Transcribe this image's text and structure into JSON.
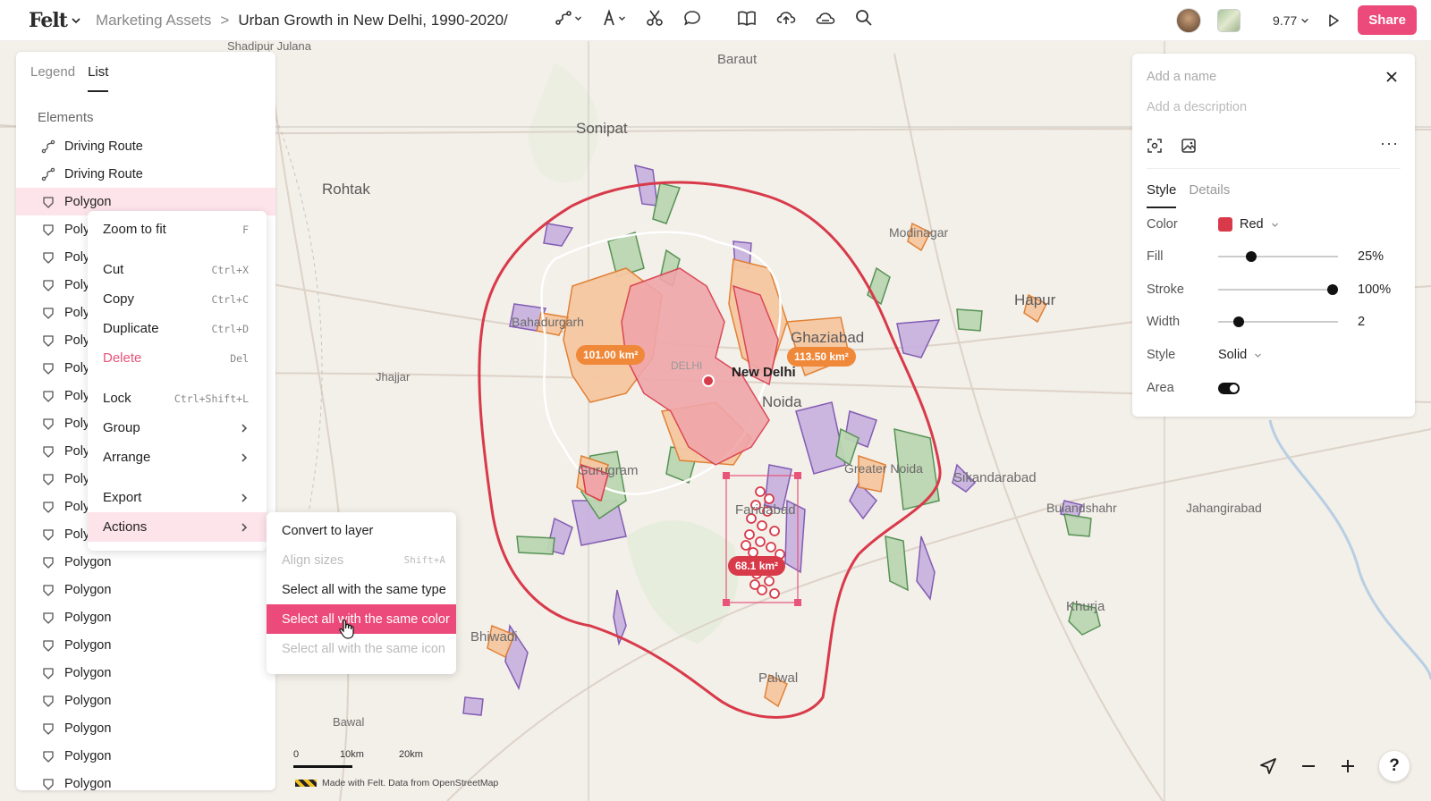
{
  "header": {
    "logo": "Felt",
    "breadcrumb_parent": "Marketing Assets",
    "breadcrumb_separator": ">",
    "map_title": "Urban Growth in New Delhi, 1990-2020/",
    "zoom": "9.77",
    "share_label": "Share"
  },
  "left_panel": {
    "tabs": [
      "Legend",
      "List"
    ],
    "section_title": "Elements",
    "items": [
      {
        "label": "Driving Route",
        "icon": "route-icon"
      },
      {
        "label": "Driving Route",
        "icon": "route-icon"
      },
      {
        "label": "Polygon",
        "icon": "polygon-icon",
        "selected": true
      },
      {
        "label": "Polygon",
        "icon": "polygon-icon"
      },
      {
        "label": "Polygon",
        "icon": "polygon-icon"
      },
      {
        "label": "Polygon",
        "icon": "polygon-icon"
      },
      {
        "label": "Polygon",
        "icon": "polygon-icon"
      },
      {
        "label": "Polygon",
        "icon": "polygon-icon"
      },
      {
        "label": "Polygon",
        "icon": "polygon-icon"
      },
      {
        "label": "Polygon",
        "icon": "polygon-icon"
      },
      {
        "label": "Polygon",
        "icon": "polygon-icon"
      },
      {
        "label": "Polygon",
        "icon": "polygon-icon"
      },
      {
        "label": "Polygon",
        "icon": "polygon-icon"
      },
      {
        "label": "Polygon",
        "icon": "polygon-icon"
      },
      {
        "label": "Polygon",
        "icon": "polygon-icon"
      },
      {
        "label": "Polygon",
        "icon": "polygon-icon"
      },
      {
        "label": "Polygon",
        "icon": "polygon-icon"
      },
      {
        "label": "Polygon",
        "icon": "polygon-icon"
      },
      {
        "label": "Polygon",
        "icon": "polygon-icon"
      },
      {
        "label": "Polygon",
        "icon": "polygon-icon"
      },
      {
        "label": "Polygon",
        "icon": "polygon-icon"
      },
      {
        "label": "Polygon",
        "icon": "polygon-icon"
      },
      {
        "label": "Polygon",
        "icon": "polygon-icon"
      },
      {
        "label": "Polygon",
        "icon": "polygon-icon"
      }
    ]
  },
  "context_menu": {
    "zoom_to_fit": {
      "label": "Zoom to fit",
      "shortcut": "F"
    },
    "cut": {
      "label": "Cut",
      "shortcut": "Ctrl+X"
    },
    "copy": {
      "label": "Copy",
      "shortcut": "Ctrl+C"
    },
    "duplicate": {
      "label": "Duplicate",
      "shortcut": "Ctrl+D"
    },
    "delete": {
      "label": "Delete",
      "shortcut": "Del"
    },
    "lock": {
      "label": "Lock",
      "shortcut": "Ctrl+Shift+L"
    },
    "group": {
      "label": "Group"
    },
    "arrange": {
      "label": "Arrange"
    },
    "export": {
      "label": "Export"
    },
    "actions": {
      "label": "Actions"
    }
  },
  "actions_submenu": {
    "convert": "Convert to layer",
    "align": {
      "label": "Align sizes",
      "shortcut": "Shift+A"
    },
    "same_type": "Select all with the same type",
    "same_color": "Select all with the same color",
    "same_icon": "Select all with the same icon"
  },
  "right_panel": {
    "name_placeholder": "Add a name",
    "description_placeholder": "Add a description",
    "tabs": [
      "Style",
      "Details"
    ],
    "color": {
      "label": "Color",
      "value": "Red",
      "hex": "#d83a4a"
    },
    "fill": {
      "label": "Fill",
      "value": "25%",
      "level": 0.25
    },
    "stroke": {
      "label": "Stroke",
      "value": "100%",
      "level": 1.0
    },
    "width": {
      "label": "Width",
      "value": "2",
      "level": 0.14
    },
    "style": {
      "label": "Style",
      "value": "Solid"
    },
    "area": {
      "label": "Area",
      "enabled": true
    }
  },
  "map": {
    "places": {
      "shadipur": "Shadipur Julana",
      "baraut": "Baraut",
      "sonipat": "Sonipat",
      "rohtak": "Rohtak",
      "modinagar": "Modinagar",
      "hapur": "Hapur",
      "bahadurgarh": "Bahadurgarh",
      "ghaziabad": "Ghaziabad",
      "delhi": "DELHI",
      "new_delhi": "New Delhi",
      "noida": "Noida",
      "jhajjar": "Jhajjar",
      "gurugram": "Gurugram",
      "greater_noida": "Greater Noida",
      "sikandrabad": "Sikandarabad",
      "bulandshahr": "Bulandshahr",
      "jahangirabad": "Jahangirabad",
      "faridabad": "Faridabad",
      "khurja": "Khurja",
      "bhiwadi": "Bhiwadi",
      "palwal": "Palwal",
      "bawal": "Bawal"
    },
    "area_labels": {
      "west": "101.00 km²",
      "east": "113.50 km²",
      "south": "68.1 km²"
    },
    "scale": {
      "zero": "0",
      "mid": "10km",
      "max": "20km"
    },
    "credit": "Made with Felt. Data from OpenStreetMap"
  }
}
